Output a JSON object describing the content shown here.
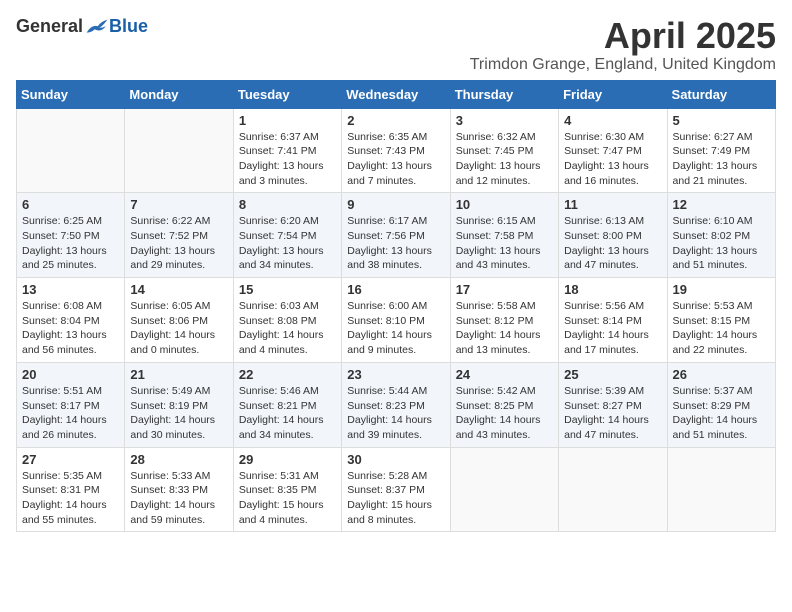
{
  "header": {
    "logo_general": "General",
    "logo_blue": "Blue",
    "month_title": "April 2025",
    "subtitle": "Trimdon Grange, England, United Kingdom"
  },
  "weekdays": [
    "Sunday",
    "Monday",
    "Tuesday",
    "Wednesday",
    "Thursday",
    "Friday",
    "Saturday"
  ],
  "weeks": [
    [
      {
        "day": "",
        "info": ""
      },
      {
        "day": "",
        "info": ""
      },
      {
        "day": "1",
        "info": "Sunrise: 6:37 AM\nSunset: 7:41 PM\nDaylight: 13 hours and 3 minutes."
      },
      {
        "day": "2",
        "info": "Sunrise: 6:35 AM\nSunset: 7:43 PM\nDaylight: 13 hours and 7 minutes."
      },
      {
        "day": "3",
        "info": "Sunrise: 6:32 AM\nSunset: 7:45 PM\nDaylight: 13 hours and 12 minutes."
      },
      {
        "day": "4",
        "info": "Sunrise: 6:30 AM\nSunset: 7:47 PM\nDaylight: 13 hours and 16 minutes."
      },
      {
        "day": "5",
        "info": "Sunrise: 6:27 AM\nSunset: 7:49 PM\nDaylight: 13 hours and 21 minutes."
      }
    ],
    [
      {
        "day": "6",
        "info": "Sunrise: 6:25 AM\nSunset: 7:50 PM\nDaylight: 13 hours and 25 minutes."
      },
      {
        "day": "7",
        "info": "Sunrise: 6:22 AM\nSunset: 7:52 PM\nDaylight: 13 hours and 29 minutes."
      },
      {
        "day": "8",
        "info": "Sunrise: 6:20 AM\nSunset: 7:54 PM\nDaylight: 13 hours and 34 minutes."
      },
      {
        "day": "9",
        "info": "Sunrise: 6:17 AM\nSunset: 7:56 PM\nDaylight: 13 hours and 38 minutes."
      },
      {
        "day": "10",
        "info": "Sunrise: 6:15 AM\nSunset: 7:58 PM\nDaylight: 13 hours and 43 minutes."
      },
      {
        "day": "11",
        "info": "Sunrise: 6:13 AM\nSunset: 8:00 PM\nDaylight: 13 hours and 47 minutes."
      },
      {
        "day": "12",
        "info": "Sunrise: 6:10 AM\nSunset: 8:02 PM\nDaylight: 13 hours and 51 minutes."
      }
    ],
    [
      {
        "day": "13",
        "info": "Sunrise: 6:08 AM\nSunset: 8:04 PM\nDaylight: 13 hours and 56 minutes."
      },
      {
        "day": "14",
        "info": "Sunrise: 6:05 AM\nSunset: 8:06 PM\nDaylight: 14 hours and 0 minutes."
      },
      {
        "day": "15",
        "info": "Sunrise: 6:03 AM\nSunset: 8:08 PM\nDaylight: 14 hours and 4 minutes."
      },
      {
        "day": "16",
        "info": "Sunrise: 6:00 AM\nSunset: 8:10 PM\nDaylight: 14 hours and 9 minutes."
      },
      {
        "day": "17",
        "info": "Sunrise: 5:58 AM\nSunset: 8:12 PM\nDaylight: 14 hours and 13 minutes."
      },
      {
        "day": "18",
        "info": "Sunrise: 5:56 AM\nSunset: 8:14 PM\nDaylight: 14 hours and 17 minutes."
      },
      {
        "day": "19",
        "info": "Sunrise: 5:53 AM\nSunset: 8:15 PM\nDaylight: 14 hours and 22 minutes."
      }
    ],
    [
      {
        "day": "20",
        "info": "Sunrise: 5:51 AM\nSunset: 8:17 PM\nDaylight: 14 hours and 26 minutes."
      },
      {
        "day": "21",
        "info": "Sunrise: 5:49 AM\nSunset: 8:19 PM\nDaylight: 14 hours and 30 minutes."
      },
      {
        "day": "22",
        "info": "Sunrise: 5:46 AM\nSunset: 8:21 PM\nDaylight: 14 hours and 34 minutes."
      },
      {
        "day": "23",
        "info": "Sunrise: 5:44 AM\nSunset: 8:23 PM\nDaylight: 14 hours and 39 minutes."
      },
      {
        "day": "24",
        "info": "Sunrise: 5:42 AM\nSunset: 8:25 PM\nDaylight: 14 hours and 43 minutes."
      },
      {
        "day": "25",
        "info": "Sunrise: 5:39 AM\nSunset: 8:27 PM\nDaylight: 14 hours and 47 minutes."
      },
      {
        "day": "26",
        "info": "Sunrise: 5:37 AM\nSunset: 8:29 PM\nDaylight: 14 hours and 51 minutes."
      }
    ],
    [
      {
        "day": "27",
        "info": "Sunrise: 5:35 AM\nSunset: 8:31 PM\nDaylight: 14 hours and 55 minutes."
      },
      {
        "day": "28",
        "info": "Sunrise: 5:33 AM\nSunset: 8:33 PM\nDaylight: 14 hours and 59 minutes."
      },
      {
        "day": "29",
        "info": "Sunrise: 5:31 AM\nSunset: 8:35 PM\nDaylight: 15 hours and 4 minutes."
      },
      {
        "day": "30",
        "info": "Sunrise: 5:28 AM\nSunset: 8:37 PM\nDaylight: 15 hours and 8 minutes."
      },
      {
        "day": "",
        "info": ""
      },
      {
        "day": "",
        "info": ""
      },
      {
        "day": "",
        "info": ""
      }
    ]
  ]
}
